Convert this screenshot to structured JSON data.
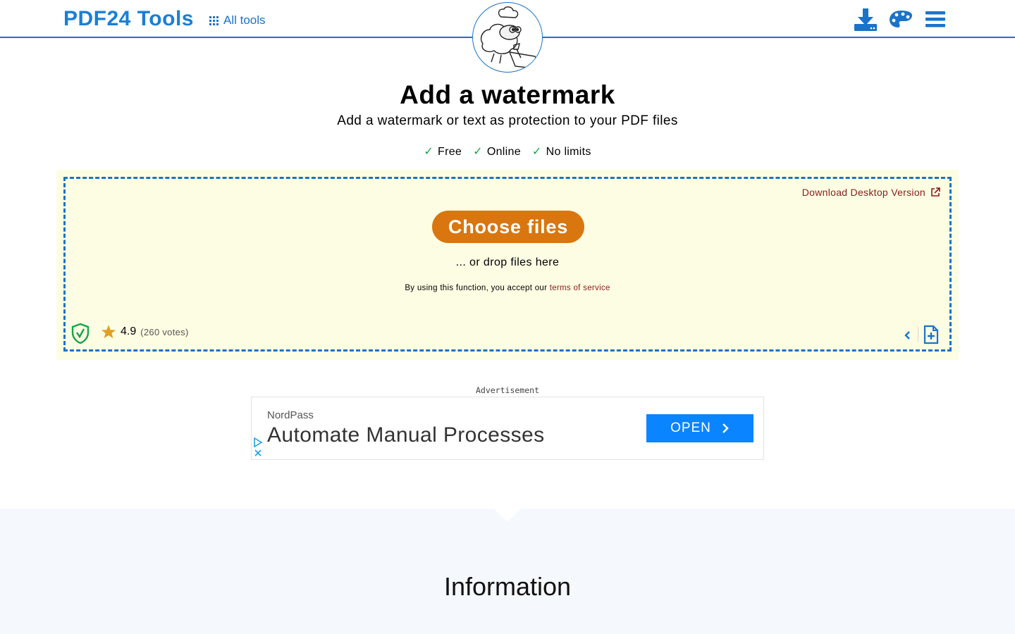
{
  "header": {
    "brand": "PDF24 Tools",
    "all_tools_label": "All tools",
    "icons": [
      "download-icon",
      "palette-icon",
      "menu-icon"
    ]
  },
  "hero": {
    "title": "Add a watermark",
    "subtitle": "Add a watermark or text as protection to your PDF files",
    "features": [
      "Free",
      "Online",
      "No limits"
    ]
  },
  "upload": {
    "desktop_link": "Download Desktop Version",
    "choose_button": "Choose files",
    "drop_text": "... or drop files here",
    "terms_prefix": "By using this function, you accept our",
    "terms_link": "terms of service",
    "rating": "4.9",
    "votes": "(260 votes)"
  },
  "ad": {
    "label": "Advertisement",
    "brand": "NordPass",
    "headline": "Automate Manual Processes",
    "cta": "OPEN"
  },
  "info": {
    "title": "Information"
  },
  "colors": {
    "accent": "#1a73c8",
    "button": "#d9760f",
    "zone_bg": "#fdfde3",
    "link": "#8b1a1a",
    "check": "#15a34a",
    "ad_cta": "#0a84ff"
  }
}
